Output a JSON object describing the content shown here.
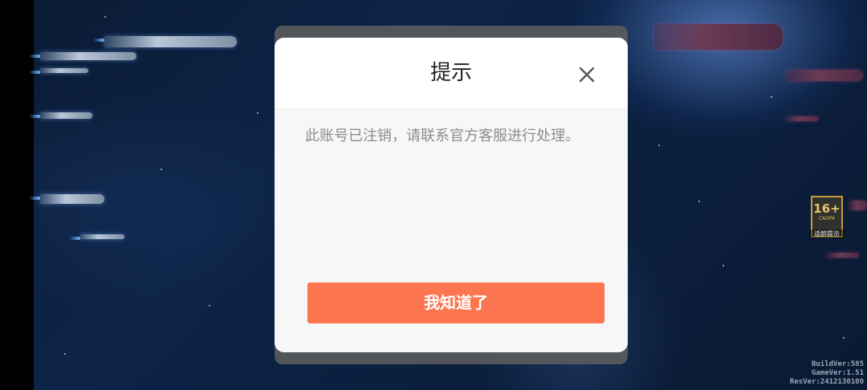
{
  "dialog": {
    "title": "提示",
    "close_icon": "close-icon",
    "message": "此账号已注销，请联系官方客服进行处理。",
    "confirm_label": "我知道了"
  },
  "age_rating": {
    "age": "16+",
    "org": "CADPA",
    "caption": "适龄提示"
  },
  "version": {
    "build": "BuildVer:585",
    "game": "GameVer:1.51",
    "res": "ResVer:2412130100"
  },
  "colors": {
    "accent": "#fa7550",
    "dialog_bg": "#f7f7f7",
    "title": "#222222",
    "message": "#8c8c8c"
  }
}
